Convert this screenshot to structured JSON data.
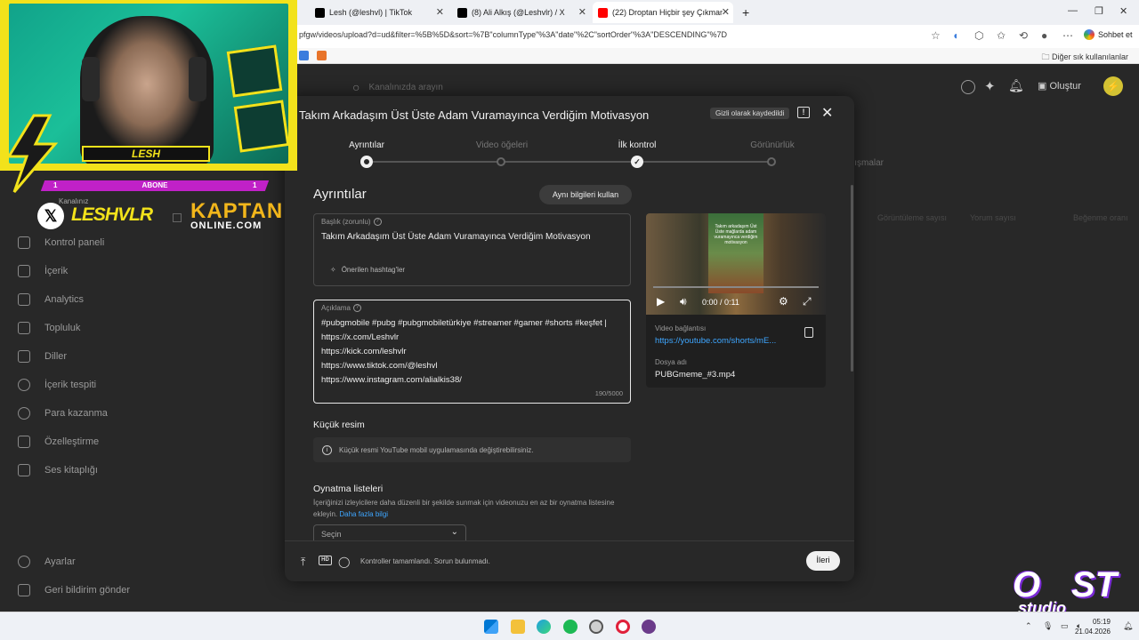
{
  "browser": {
    "tabs": [
      {
        "title": "Lesh (@leshvl) | TikTok",
        "icon": "tiktok-icon",
        "color": "#000000"
      },
      {
        "title": "(8) Ali Alkış (@Leshvlr) / X",
        "icon": "x-icon",
        "color": "#000000"
      },
      {
        "title": "(22) Droptan Hiçbir şey Çıkmamışt",
        "icon": "youtube-icon",
        "color": "#ff0000"
      }
    ],
    "new_tab": "+",
    "url": "pfgw/videos/upload?d=ud&filter=%5B%5D&sort=%7B\"columnType\"%3A\"date\"%2C\"sortOrder\"%3A\"DESCENDING\"%7D",
    "chat_button": "Sohbet et",
    "favorites_label": "Diğer sık kullanılanlar"
  },
  "studio": {
    "search_placeholder": "Kanalınızda arayın",
    "create_button": "Oluştur",
    "channel_label": "Kanalınız",
    "nav": [
      {
        "label": "Kontrol paneli"
      },
      {
        "label": "İçerik"
      },
      {
        "label": "Analytics"
      },
      {
        "label": "Topluluk"
      },
      {
        "label": "Diller"
      },
      {
        "label": "İçerik tespiti"
      },
      {
        "label": "Para kazanma"
      },
      {
        "label": "Özelleştirme"
      },
      {
        "label": "Ses kitaplığı"
      }
    ],
    "nav_bottom": [
      {
        "label": "Ayarlar"
      },
      {
        "label": "Geri bildirim gönder"
      }
    ],
    "bg_tab": "lışmalar",
    "bg_columns": [
      "Görüntüleme sayısı",
      "Yorum sayısı",
      "Beğenme oranı"
    ]
  },
  "modal": {
    "title": "Takım Arkadaşım Üst Üste Adam Vuramayınca Verdiğim Motivasyon",
    "saved_badge": "Gizli olarak kaydedildi",
    "steps": [
      {
        "label": "Ayrıntılar",
        "state": "current"
      },
      {
        "label": "Video öğeleri",
        "state": "upcoming"
      },
      {
        "label": "İlk kontrol",
        "state": "done"
      },
      {
        "label": "Görünürlük",
        "state": "upcoming"
      }
    ],
    "section_title": "Ayrıntılar",
    "same_info_button": "Aynı bilgileri kullan",
    "title_field": {
      "label": "Başlık (zorunlu)",
      "value": "Takım Arkadaşım Üst Üste Adam Vuramayınca Verdiğim Motivasyon",
      "hashtags": "Önerilen hashtag'ler"
    },
    "description_field": {
      "label": "Açıklama",
      "lines": [
        "#pubgmobile #pubg #pubgmobiletürkiye #streamer #gamer #shorts #keşfet |",
        "https://x.com/Leshvlr",
        "https://kick.com/leshvlr",
        "https://www.tiktok.com/@leshvl",
        "https://www.instagram.com/alialkis38/"
      ],
      "char_count": "190/5000"
    },
    "thumbnail": {
      "title": "Küçük resim",
      "info": "Küçük resmi YouTube mobil uygulamasında değiştirebilirsiniz."
    },
    "playlists": {
      "title": "Oynatma listeleri",
      "desc": "İçeriğinizi izleyicilere daha düzenli bir şekilde sunmak için videonuzu en az bir oynatma listesine ekleyin.",
      "link": "Daha fazla bilgi",
      "select_placeholder": "Seçin"
    },
    "video": {
      "caption": "Takım arkadaşım Üst Üste mağlarda adam vuramayınca verdiğim motivasyon",
      "time": "0:00 / 0:11",
      "progress": 0,
      "link_label": "Video bağlantısı",
      "link": "https://youtube.com/shorts/mE...",
      "filename_label": "Dosya adı",
      "filename": "PUBGmeme_#3.mp4"
    },
    "footer": {
      "status": "Kontroller tamamlandı. Sorun bulunmadı.",
      "next_button": "İleri"
    }
  },
  "overlay": {
    "streamer_name": "LESH",
    "subscribe_label": "ABONE",
    "subscribe_left": "1",
    "subscribe_right": "1",
    "x_handle": "LESHVLR",
    "sponsor": "KAPTAN",
    "sponsor_sub": "ONLINE.COM",
    "logo_o": "O",
    "logo_st": "ST",
    "logo_studio": "studio"
  },
  "taskbar": {
    "time": "05:19",
    "date": "21.04.2026"
  },
  "colors": {
    "accent_blue": "#3ea6ff",
    "overlay_yellow": "#f2e21b",
    "overlay_magenta": "#c021c7",
    "modal_bg": "#282828"
  }
}
